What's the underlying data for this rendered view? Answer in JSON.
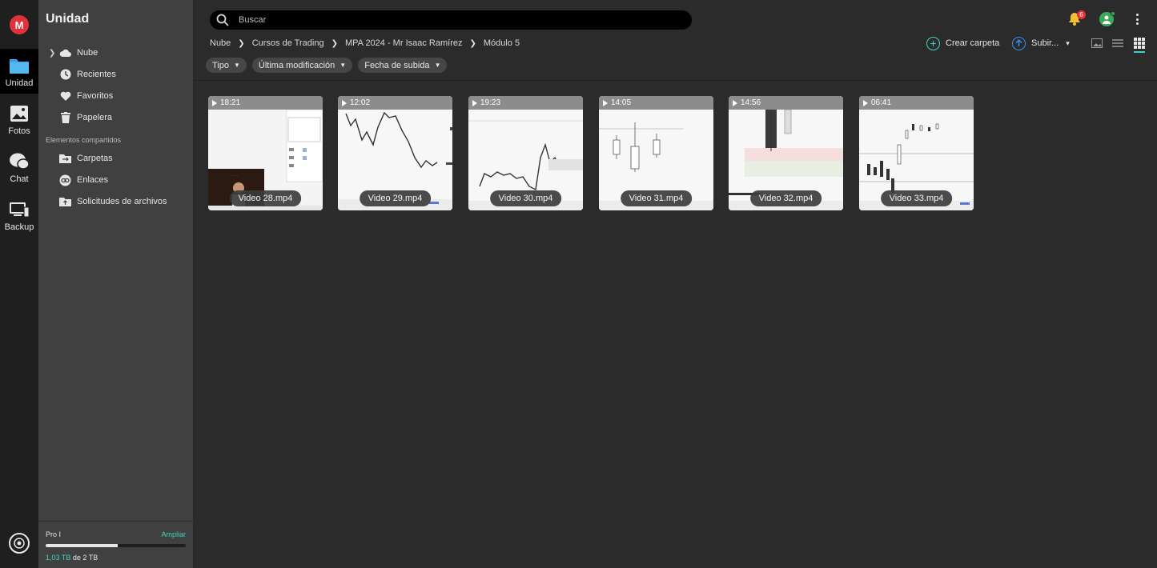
{
  "rail": {
    "logo": "M",
    "items": [
      {
        "label": "Unidad",
        "icon": "folder-icon"
      },
      {
        "label": "Fotos",
        "icon": "photos-icon"
      },
      {
        "label": "Chat",
        "icon": "chat-icon"
      },
      {
        "label": "Backup",
        "icon": "backup-icon"
      }
    ]
  },
  "panel": {
    "title": "Unidad",
    "nav": [
      {
        "label": "Nube",
        "icon": "cloud-icon"
      },
      {
        "label": "Recientes",
        "icon": "clock-icon"
      },
      {
        "label": "Favoritos",
        "icon": "heart-icon"
      },
      {
        "label": "Papelera",
        "icon": "trash-icon"
      }
    ],
    "shared_section": "Elementos compartidos",
    "shared": [
      {
        "label": "Carpetas",
        "icon": "shared-folder-icon"
      },
      {
        "label": "Enlaces",
        "icon": "link-icon"
      },
      {
        "label": "Solicitudes de archivos",
        "icon": "file-request-icon"
      }
    ],
    "storage": {
      "plan": "Pro I",
      "upgrade": "Ampliar",
      "used": "1,03 TB",
      "of": "de 2 TB",
      "fraction": 0.515
    }
  },
  "search": {
    "placeholder": "Buscar"
  },
  "notifications": {
    "count": "6"
  },
  "breadcrumb": [
    "Nube",
    "Cursos de Trading",
    "MPA 2024 - Mr Isaac Ramírez",
    "Módulo 5"
  ],
  "actions": {
    "create_folder": "Crear carpeta",
    "upload": "Subir..."
  },
  "filters": [
    "Tipo",
    "Última modificación",
    "Fecha de subida"
  ],
  "files": [
    {
      "name": "Video 28.mp4",
      "duration": "18:21"
    },
    {
      "name": "Video 29.mp4",
      "duration": "12:02"
    },
    {
      "name": "Video 30.mp4",
      "duration": "19:23"
    },
    {
      "name": "Video 31.mp4",
      "duration": "14:05"
    },
    {
      "name": "Video 32.mp4",
      "duration": "14:56"
    },
    {
      "name": "Video 33.mp4",
      "duration": "06:41"
    }
  ],
  "colors": {
    "accent": "#3fd3c1",
    "brand": "#e0323a",
    "avatar": "#3ea65a"
  }
}
